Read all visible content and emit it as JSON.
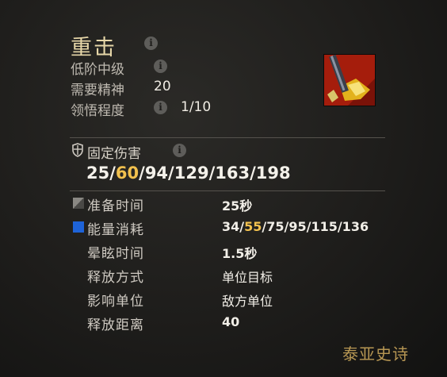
{
  "skill": {
    "name": "重击",
    "tier": "低阶中级",
    "requirement_label": "需要精神",
    "requirement_value": "20",
    "mastery_label": "领悟程度",
    "mastery_value": "1/10"
  },
  "damage": {
    "label": "固定伤害",
    "values": [
      "25",
      "60",
      "94",
      "129",
      "163",
      "198"
    ],
    "highlight_index": 1
  },
  "stats": [
    {
      "label": "准备时间",
      "value": "25秒"
    },
    {
      "label": "能量消耗",
      "value_parts": [
        "34/",
        "55",
        "/75/95/115/136"
      ]
    },
    {
      "label": "晕眩时间",
      "value": "1.5秒"
    },
    {
      "label": "释放方式",
      "value": "单位目标"
    },
    {
      "label": "影响单位",
      "value": "敌方单位"
    },
    {
      "label": "释放距离",
      "value": "40"
    }
  ],
  "watermark": "泰亚史诗",
  "colors": {
    "highlight": "#f2c14e",
    "title": "#e6d6a8",
    "energy": "#1e63d8"
  },
  "icons": {
    "info": "info-icon",
    "shield": "shield-icon",
    "cooldown": "cooldown-icon",
    "energy": "energy-icon"
  }
}
